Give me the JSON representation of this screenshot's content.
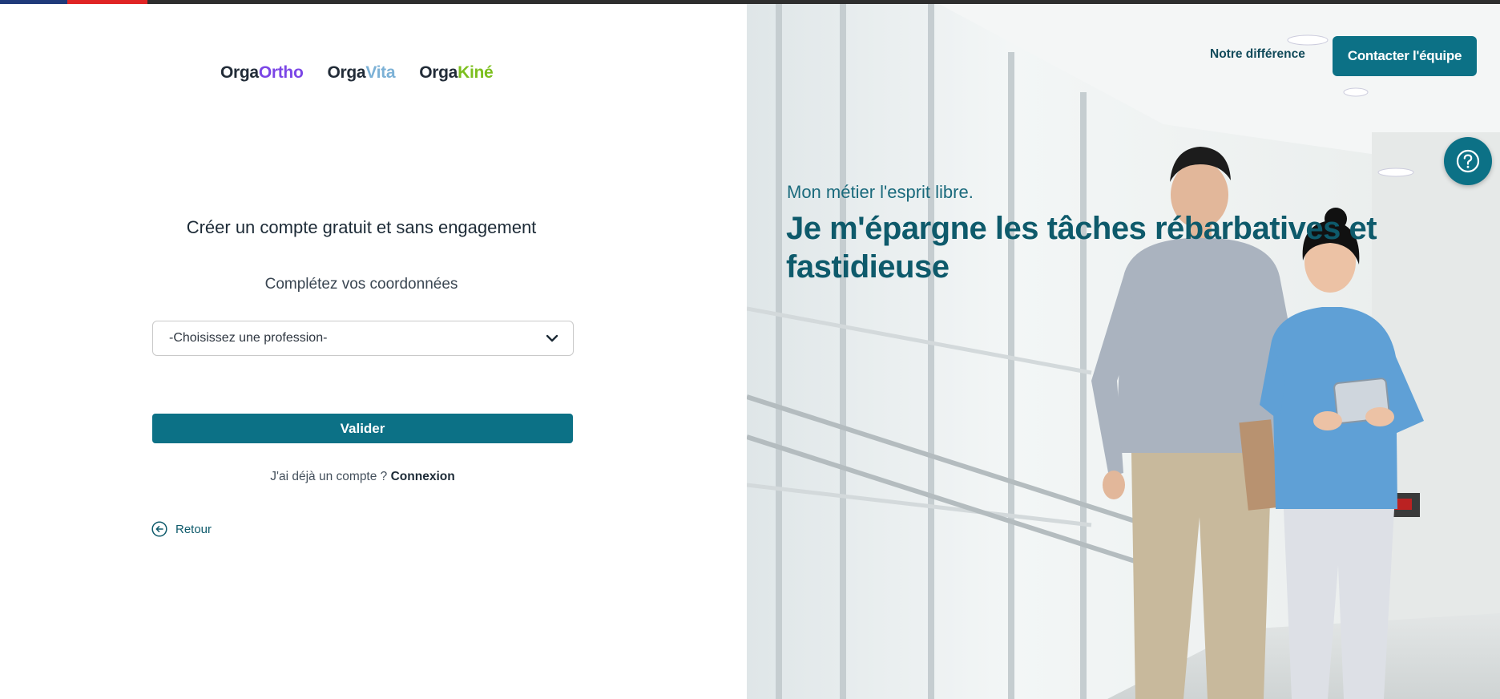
{
  "header": {
    "nav_link": "Notre différence",
    "contact_button": "Contacter l'équipe"
  },
  "logos": [
    {
      "prefix": "Orga",
      "suffix": "Ortho"
    },
    {
      "prefix": "Orga",
      "suffix": "Vita"
    },
    {
      "prefix": "Orga",
      "suffix": "Kiné"
    }
  ],
  "form": {
    "title": "Créer un compte gratuit et sans engagement",
    "subtitle": "Complétez vos coordonnées",
    "profession_select": "-Choisissez une profession-",
    "submit_label": "Valider",
    "already_text": "J'ai déjà un compte ?",
    "login_link": "Connexion",
    "back_label": "Retour"
  },
  "hero": {
    "tagline": "Mon métier l'esprit libre.",
    "title": "Je m'épargne les tâches rébarbatives et fastidieuse"
  },
  "colors": {
    "primary": "#0c7186",
    "ortho": "#7b46e6",
    "vita": "#7cb1d6",
    "kine": "#7cbf1e"
  },
  "icons": {
    "help": "question-circle-icon",
    "back": "arrow-left-circle-icon",
    "select": "chevron-down-icon"
  }
}
